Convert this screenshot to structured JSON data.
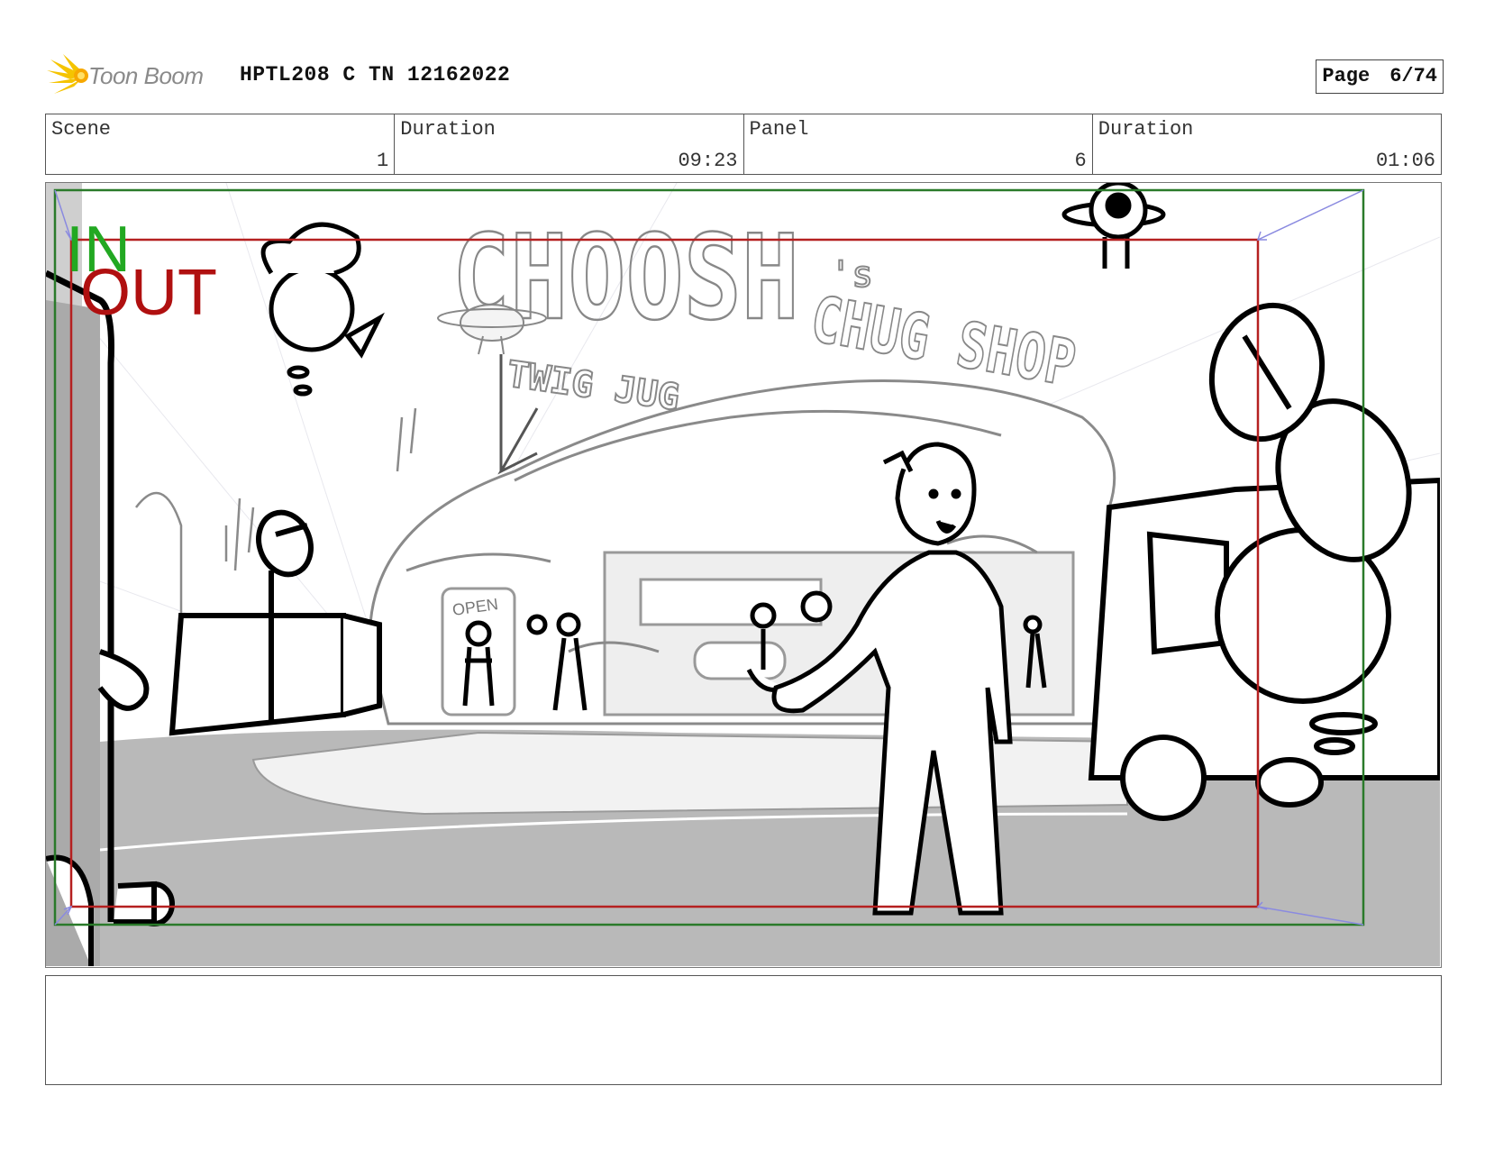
{
  "header": {
    "logo_text": "Toon Boom",
    "project_title": "HPTL208 C TN 12162022",
    "page_label": "Page",
    "page_number": "6/74"
  },
  "info": {
    "scene_label": "Scene",
    "scene_value": "1",
    "scene_duration_label": "Duration",
    "scene_duration_value": "09:23",
    "panel_label": "Panel",
    "panel_value": "6",
    "panel_duration_label": "Duration",
    "panel_duration_value": "01:06"
  },
  "panel": {
    "in_label": "IN",
    "out_label": "OUT",
    "sign_main": "CHOOSH",
    "sign_suffix": "'s",
    "sign_secondary": "CHUG SHOP",
    "back_sign": "TWIG JUG",
    "door_sign": "OPEN",
    "colors": {
      "in": "#22a822",
      "out": "#b01010",
      "safe_green": "#2a7a2a",
      "safe_red": "#b52020",
      "camera_blue": "#8a8ae0"
    }
  },
  "notes": {
    "text": ""
  }
}
